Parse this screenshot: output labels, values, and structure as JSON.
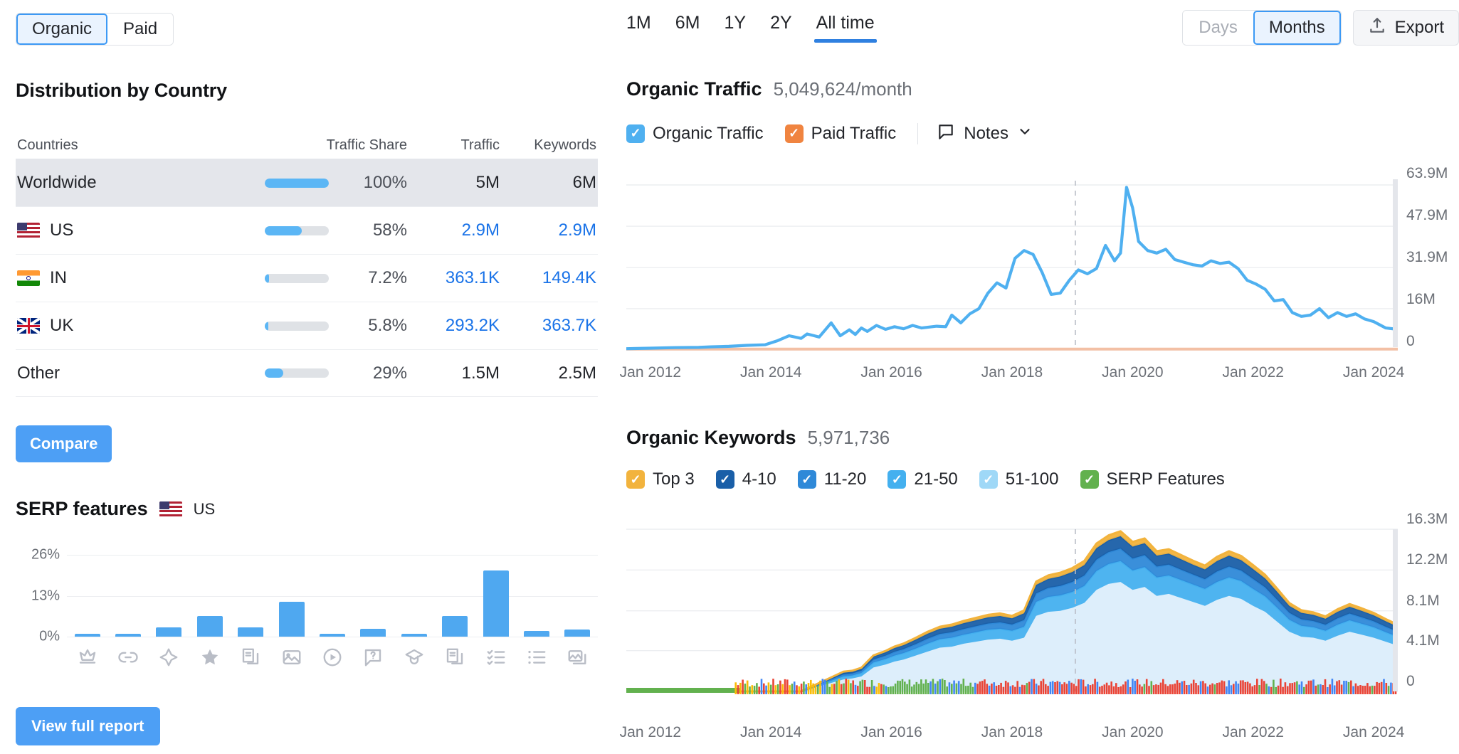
{
  "left_panel": {
    "traffic_type_toggle": {
      "options": [
        "Organic",
        "Paid"
      ],
      "selected": "Organic"
    },
    "distribution": {
      "title": "Distribution by Country",
      "columns": [
        "Countries",
        "Traffic Share",
        "Traffic",
        "Keywords"
      ],
      "rows": [
        {
          "country": "Worldwide",
          "flag": null,
          "share_pct": 100,
          "share_label": "100%",
          "traffic": "5M",
          "keywords": "6M",
          "highlight": true,
          "linked": false
        },
        {
          "country": "US",
          "flag": "us-flag-icon",
          "share_pct": 58,
          "share_label": "58%",
          "traffic": "2.9M",
          "keywords": "2.9M",
          "highlight": false,
          "linked": true
        },
        {
          "country": "IN",
          "flag": "in-flag-icon",
          "share_pct": 7.2,
          "share_label": "7.2%",
          "traffic": "363.1K",
          "keywords": "149.4K",
          "highlight": false,
          "linked": true
        },
        {
          "country": "UK",
          "flag": "uk-flag-icon",
          "share_pct": 5.8,
          "share_label": "5.8%",
          "traffic": "293.2K",
          "keywords": "363.7K",
          "highlight": false,
          "linked": true
        },
        {
          "country": "Other",
          "flag": null,
          "share_pct": 29,
          "share_label": "29%",
          "traffic": "1.5M",
          "keywords": "2.5M",
          "highlight": false,
          "linked": false
        }
      ]
    },
    "compare_button": "Compare",
    "view_full_report_button": "View full report",
    "serp_features": {
      "title": "SERP features",
      "country_label": "US",
      "country_flag": "us-flag-icon"
    }
  },
  "right_panel": {
    "range_tabs": {
      "options": [
        "1M",
        "6M",
        "1Y",
        "2Y",
        "All time"
      ],
      "selected": "All time"
    },
    "granularity_toggle": {
      "options": [
        "Days",
        "Months"
      ],
      "selected": "Months"
    },
    "export_button": "Export",
    "organic_traffic": {
      "title": "Organic Traffic",
      "value": "5,049,624/month",
      "legend": [
        {
          "label": "Organic Traffic",
          "color": "#4fb0f0",
          "checked": true
        },
        {
          "label": "Paid Traffic",
          "color": "#f08440",
          "checked": true
        }
      ],
      "notes_label": "Notes"
    },
    "organic_keywords": {
      "title": "Organic Keywords",
      "value": "5,971,736",
      "legend": [
        {
          "label": "Top 3",
          "color": "#f2b33d",
          "checked": true
        },
        {
          "label": "4-10",
          "color": "#1a5fa8",
          "checked": true
        },
        {
          "label": "11-20",
          "color": "#2f89d8",
          "checked": true
        },
        {
          "label": "21-50",
          "color": "#44b0ef",
          "checked": true
        },
        {
          "label": "51-100",
          "color": "#9fd8f7",
          "checked": true
        },
        {
          "label": "SERP Features",
          "color": "#62b14e",
          "checked": true
        }
      ]
    }
  },
  "chart_data": [
    {
      "type": "bar",
      "title": "SERP features",
      "xlabel": "",
      "ylabel": "",
      "ylim": [
        0,
        26
      ],
      "ytick_labels": [
        "26%",
        "13%",
        "0%"
      ],
      "yticks": [
        26,
        13,
        0
      ],
      "grid": true,
      "categories": [
        "featured-snippet",
        "sitelinks",
        "ai-overview",
        "reviews",
        "knowledge-panel",
        "image",
        "video",
        "faq",
        "instant-answer",
        "people-also-ask",
        "checklist",
        "list",
        "image-pack"
      ],
      "values": [
        0.8,
        0.8,
        3.0,
        6.5,
        3.0,
        11.0,
        0.8,
        2.5,
        0.8,
        6.5,
        21.0,
        1.8,
        2.2
      ]
    },
    {
      "type": "line",
      "title": "Organic Traffic",
      "xlabel": "",
      "ylabel": "",
      "ylim": [
        0,
        63.9
      ],
      "ytick_labels": [
        "63.9M",
        "47.9M",
        "31.9M",
        "16M",
        "0"
      ],
      "yticks": [
        63.9,
        47.9,
        31.9,
        16,
        0
      ],
      "xtick_labels": [
        "Jan 2012",
        "Jan 2014",
        "Jan 2016",
        "Jan 2018",
        "Jan 2020",
        "Jan 2022",
        "Jan 2024"
      ],
      "xticks": [
        2012,
        2014,
        2016,
        2018,
        2020,
        2022,
        2024
      ],
      "grid": true,
      "annotation_vline": "Jan 2019",
      "series": [
        {
          "name": "Organic Traffic",
          "color": "#4fb0f0",
          "x": [
            2011.6,
            2012.0,
            2012.4,
            2012.8,
            2013.0,
            2013.3,
            2013.6,
            2013.9,
            2014.1,
            2014.3,
            2014.5,
            2014.6,
            2014.8,
            2015.0,
            2015.15,
            2015.3,
            2015.4,
            2015.5,
            2015.6,
            2015.75,
            2015.9,
            2016.05,
            2016.2,
            2016.35,
            2016.5,
            2016.6,
            2016.75,
            2016.9,
            2017.0,
            2017.15,
            2017.3,
            2017.45,
            2017.6,
            2017.75,
            2017.9,
            2018.05,
            2018.2,
            2018.35,
            2018.5,
            2018.65,
            2018.8,
            2018.95,
            2019.1,
            2019.25,
            2019.4,
            2019.55,
            2019.7,
            2019.8,
            2019.9,
            2020.0,
            2020.1,
            2020.25,
            2020.4,
            2020.55,
            2020.7,
            2020.85,
            2021.0,
            2021.15,
            2021.3,
            2021.45,
            2021.6,
            2021.75,
            2021.9,
            2022.05,
            2022.2,
            2022.35,
            2022.5,
            2022.65,
            2022.8,
            2022.95,
            2023.1,
            2023.25,
            2023.4,
            2023.55,
            2023.7,
            2023.85,
            2024.0,
            2024.2,
            2024.4
          ],
          "y": [
            0.5,
            0.7,
            0.9,
            1.0,
            1.2,
            1.4,
            1.8,
            2.0,
            3.5,
            5.5,
            4.5,
            6.2,
            5.0,
            10.5,
            5.5,
            7.8,
            6.0,
            8.5,
            7.2,
            9.5,
            8.0,
            9.0,
            8.2,
            9.5,
            8.5,
            8.8,
            9.2,
            9.0,
            13.5,
            10.5,
            14.0,
            16.0,
            22.0,
            26.0,
            24.0,
            35.5,
            38.5,
            37.0,
            30.0,
            21.5,
            22.0,
            27.0,
            31.0,
            29.5,
            31.5,
            40.5,
            34.5,
            37.5,
            63.0,
            55.0,
            42.0,
            38.5,
            37.5,
            39.0,
            35.0,
            34.0,
            33.0,
            32.5,
            34.5,
            33.5,
            34.0,
            31.5,
            27.0,
            25.5,
            23.5,
            19.0,
            19.5,
            14.5,
            13.0,
            13.5,
            16.0,
            12.5,
            14.5,
            13.0,
            14.0,
            12.0,
            11.0,
            8.5,
            8.0
          ]
        },
        {
          "name": "Paid Traffic",
          "color": "#f3c0a5",
          "x": [
            2011.6,
            2024.4
          ],
          "y": [
            0.35,
            0.35
          ]
        }
      ]
    },
    {
      "type": "area",
      "title": "Organic Keywords",
      "xlabel": "",
      "ylabel": "",
      "ylim": [
        0,
        16.3
      ],
      "ytick_labels": [
        "16.3M",
        "12.2M",
        "8.1M",
        "4.1M",
        "0"
      ],
      "yticks": [
        16.3,
        12.2,
        8.1,
        4.1,
        0
      ],
      "xtick_labels": [
        "Jan 2012",
        "Jan 2014",
        "Jan 2016",
        "Jan 2018",
        "Jan 2020",
        "Jan 2022",
        "Jan 2024"
      ],
      "xticks": [
        2012,
        2014,
        2016,
        2018,
        2020,
        2022,
        2024
      ],
      "grid": true,
      "annotation_vline": "Jan 2019",
      "stacked": true,
      "x": [
        2011.6,
        2012.5,
        2013.5,
        2014.5,
        2015.2,
        2015.35,
        2015.5,
        2015.7,
        2015.9,
        2016.05,
        2016.2,
        2016.4,
        2016.6,
        2016.8,
        2017.0,
        2017.2,
        2017.4,
        2017.6,
        2017.8,
        2018.0,
        2018.2,
        2018.4,
        2018.6,
        2018.8,
        2019.0,
        2019.2,
        2019.4,
        2019.6,
        2019.8,
        2020.0,
        2020.2,
        2020.4,
        2020.6,
        2020.8,
        2021.0,
        2021.2,
        2021.4,
        2021.6,
        2021.8,
        2022.0,
        2022.2,
        2022.4,
        2022.6,
        2022.8,
        2023.0,
        2023.2,
        2023.4,
        2023.6,
        2023.8,
        2024.0,
        2024.2,
        2024.4
      ],
      "series": [
        {
          "name": "51-100",
          "color": "#ddeefb",
          "values": [
            0,
            0,
            0,
            0,
            1.2,
            1.3,
            1.5,
            2.4,
            2.7,
            3.0,
            3.2,
            3.6,
            4.0,
            4.4,
            4.5,
            4.8,
            5.0,
            5.2,
            5.3,
            5.1,
            5.4,
            7.6,
            8.0,
            8.1,
            8.4,
            8.9,
            10.2,
            10.8,
            11.0,
            10.2,
            10.5,
            9.6,
            9.8,
            9.4,
            9.0,
            8.6,
            9.2,
            9.6,
            9.3,
            8.6,
            8.0,
            7.0,
            6.0,
            5.5,
            5.4,
            5.1,
            5.6,
            6.0,
            5.7,
            5.4,
            5.0,
            4.6
          ]
        },
        {
          "name": "21-50",
          "color": "#44b0ef",
          "values": [
            0,
            0,
            0,
            0,
            0.3,
            0.3,
            0.35,
            0.5,
            0.55,
            0.6,
            0.65,
            0.7,
            0.8,
            0.85,
            0.9,
            0.9,
            0.95,
            1.0,
            1.0,
            1.0,
            1.1,
            1.4,
            1.5,
            1.55,
            1.6,
            1.7,
            1.9,
            2.0,
            2.1,
            1.95,
            2.0,
            1.85,
            1.85,
            1.8,
            1.75,
            1.7,
            1.8,
            1.85,
            1.8,
            1.7,
            1.55,
            1.4,
            1.2,
            1.1,
            1.05,
            1.0,
            1.1,
            1.15,
            1.1,
            1.05,
            0.95,
            0.9
          ]
        },
        {
          "name": "11-20",
          "color": "#2f89d8",
          "values": [
            0,
            0,
            0,
            0,
            0.2,
            0.2,
            0.22,
            0.3,
            0.34,
            0.38,
            0.4,
            0.45,
            0.5,
            0.52,
            0.55,
            0.58,
            0.6,
            0.62,
            0.64,
            0.62,
            0.68,
            0.85,
            0.9,
            0.95,
            1.0,
            1.05,
            1.15,
            1.2,
            1.25,
            1.2,
            1.2,
            1.1,
            1.1,
            1.05,
            1.0,
            0.98,
            1.05,
            1.1,
            1.05,
            1.0,
            0.9,
            0.8,
            0.7,
            0.65,
            0.62,
            0.6,
            0.65,
            0.68,
            0.65,
            0.6,
            0.55,
            0.5
          ]
        },
        {
          "name": "4-10",
          "color": "#1a5fa8",
          "values": [
            0,
            0,
            0,
            0,
            0.2,
            0.2,
            0.22,
            0.3,
            0.34,
            0.38,
            0.4,
            0.45,
            0.5,
            0.52,
            0.55,
            0.58,
            0.6,
            0.62,
            0.64,
            0.62,
            0.68,
            0.85,
            0.9,
            0.95,
            1.0,
            1.05,
            1.15,
            1.2,
            1.25,
            1.2,
            1.2,
            1.1,
            1.1,
            1.05,
            1.0,
            0.98,
            1.05,
            1.1,
            1.05,
            1.0,
            0.9,
            0.8,
            0.7,
            0.65,
            0.62,
            0.6,
            0.65,
            0.68,
            0.65,
            0.6,
            0.55,
            0.5
          ]
        },
        {
          "name": "Top 3",
          "color": "#f2b33d",
          "values": [
            0,
            0,
            0,
            0,
            0.08,
            0.08,
            0.09,
            0.12,
            0.14,
            0.15,
            0.16,
            0.18,
            0.2,
            0.21,
            0.22,
            0.23,
            0.24,
            0.25,
            0.26,
            0.25,
            0.27,
            0.34,
            0.36,
            0.38,
            0.4,
            0.42,
            0.46,
            0.48,
            0.5,
            0.48,
            0.48,
            0.44,
            0.44,
            0.42,
            0.4,
            0.39,
            0.42,
            0.44,
            0.42,
            0.4,
            0.36,
            0.32,
            0.28,
            0.26,
            0.25,
            0.24,
            0.26,
            0.27,
            0.26,
            0.24,
            0.22,
            0.2
          ]
        }
      ],
      "update_markers_band": {
        "description": "Google algorithm update markers and SERP volatility bars along the baseline",
        "colors": [
          "#62b14e",
          "#4285f4",
          "#ea4335",
          "#fbbc05"
        ]
      }
    }
  ]
}
